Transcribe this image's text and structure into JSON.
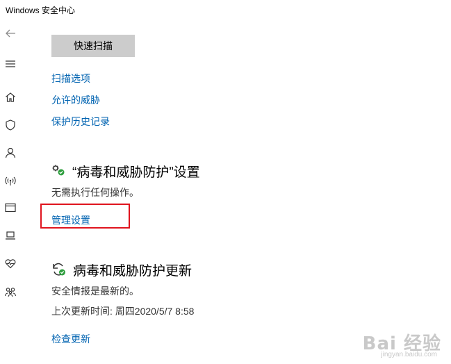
{
  "window": {
    "title": "Windows 安全中心"
  },
  "sidebar": {
    "items": [
      {
        "icon": "back-arrow-icon"
      },
      {
        "icon": "hamburger-menu-icon"
      },
      {
        "icon": "home-icon"
      },
      {
        "icon": "shield-icon"
      },
      {
        "icon": "person-icon"
      },
      {
        "icon": "wireless-icon"
      },
      {
        "icon": "app-browser-icon"
      },
      {
        "icon": "laptop-icon"
      },
      {
        "icon": "heart-pulse-icon"
      },
      {
        "icon": "family-icon"
      }
    ]
  },
  "scan": {
    "quick_scan_label": "快速扫描",
    "links": [
      "扫描选项",
      "允许的威胁",
      "保护历史记录"
    ]
  },
  "settings_section": {
    "icon": "gear-check-icon",
    "title": "“病毒和威胁防护”设置",
    "status": "无需执行任何操作。",
    "manage_link": "管理设置"
  },
  "update_section": {
    "icon": "refresh-check-icon",
    "title": "病毒和威胁防护更新",
    "status": "安全情报是最新的。",
    "last_update": "上次更新时间: 周四2020/5/7 8:58",
    "check_link": "检查更新"
  },
  "watermark": {
    "main": "Bai 经验",
    "sub": "jingyan.baidu.com"
  },
  "colors": {
    "link": "#0063b1",
    "highlight": "#e0141e",
    "check_green": "#2e9e3e"
  }
}
